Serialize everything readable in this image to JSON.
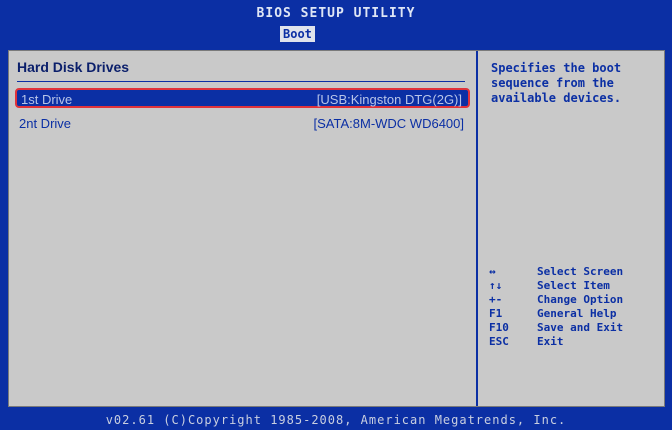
{
  "header": {
    "title": "BIOS SETUP UTILITY",
    "active_tab": "Boot"
  },
  "section": {
    "title": "Hard Disk Drives"
  },
  "drives": [
    {
      "label": "1st Drive",
      "value": "[USB:Kingston DTG(2G)]"
    },
    {
      "label": "2nt Drive",
      "value": "[SATA:8M-WDC WD6400]"
    }
  ],
  "help": {
    "text": "Specifies the boot sequence from the available devices."
  },
  "keys": [
    {
      "key": "↔",
      "desc": "Select Screen"
    },
    {
      "key": "↑↓",
      "desc": "Select Item"
    },
    {
      "key": "+-",
      "desc": "Change Option"
    },
    {
      "key": "F1",
      "desc": "General Help"
    },
    {
      "key": "F10",
      "desc": "Save and Exit"
    },
    {
      "key": "ESC",
      "desc": "Exit"
    }
  ],
  "footer": {
    "text": "v02.61 (C)Copyright 1985-2008, American Megatrends, Inc."
  },
  "colors": {
    "background": "#0b2fa4",
    "panel": "#c9c9c9",
    "highlight_border": "#e0333b"
  }
}
